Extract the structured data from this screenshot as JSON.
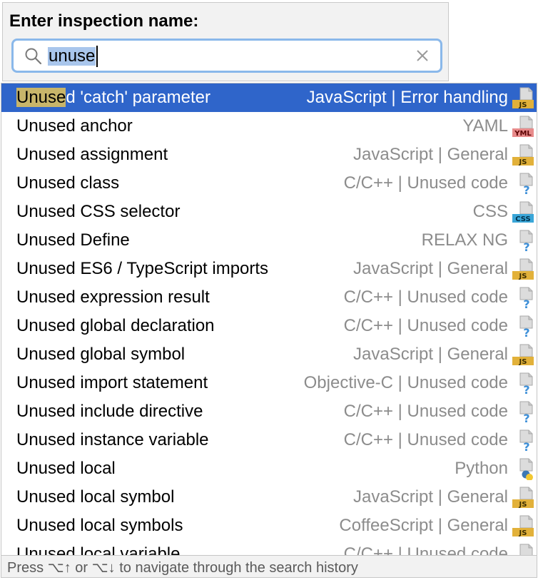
{
  "header": {
    "title": "Enter inspection name:",
    "search_value": "unuse",
    "icons": {
      "search": "search-icon",
      "clear": "clear-icon"
    }
  },
  "colors": {
    "accent": "#2f65ca",
    "match_highlight": "#c8b56a",
    "secondary_text": "#8c8c8c",
    "focus_border": "#8ab8ea"
  },
  "results": [
    {
      "match": "Unuse",
      "rest": "d 'catch' parameter",
      "category": "JavaScript | Error handling",
      "icon": "js",
      "selected": true
    },
    {
      "match": "",
      "rest": "Unused anchor",
      "category": "YAML",
      "icon": "yml"
    },
    {
      "match": "",
      "rest": "Unused assignment",
      "category": "JavaScript | General",
      "icon": "js"
    },
    {
      "match": "",
      "rest": "Unused class",
      "category": "C/C++ | Unused code",
      "icon": "unknown"
    },
    {
      "match": "",
      "rest": "Unused CSS selector",
      "category": "CSS",
      "icon": "css"
    },
    {
      "match": "",
      "rest": "Unused Define",
      "category": "RELAX NG",
      "icon": "unknown"
    },
    {
      "match": "",
      "rest": "Unused ES6 / TypeScript imports",
      "category": "JavaScript | General",
      "icon": "js"
    },
    {
      "match": "",
      "rest": "Unused expression result",
      "category": "C/C++ | Unused code",
      "icon": "unknown"
    },
    {
      "match": "",
      "rest": "Unused global declaration",
      "category": "C/C++ | Unused code",
      "icon": "unknown"
    },
    {
      "match": "",
      "rest": "Unused global symbol",
      "category": "JavaScript | General",
      "icon": "js"
    },
    {
      "match": "",
      "rest": "Unused import statement",
      "category": "Objective-C | Unused code",
      "icon": "unknown"
    },
    {
      "match": "",
      "rest": "Unused include directive",
      "category": "C/C++ | Unused code",
      "icon": "unknown"
    },
    {
      "match": "",
      "rest": "Unused instance variable",
      "category": "C/C++ | Unused code",
      "icon": "unknown"
    },
    {
      "match": "",
      "rest": "Unused local",
      "category": "Python",
      "icon": "python"
    },
    {
      "match": "",
      "rest": "Unused local symbol",
      "category": "JavaScript | General",
      "icon": "js"
    },
    {
      "match": "",
      "rest": "Unused local symbols",
      "category": "CoffeeScript | General",
      "icon": "js"
    },
    {
      "match": "",
      "rest": "Unused local variable",
      "category": "C/C++ | Unused code",
      "icon": "unknown"
    }
  ],
  "footer": {
    "hint": "Press ⌥↑ or ⌥↓ to navigate through the search history"
  }
}
